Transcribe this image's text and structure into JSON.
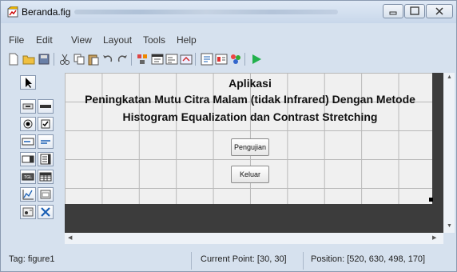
{
  "window": {
    "title": "Beranda.fig"
  },
  "menu": [
    "File",
    "Edit",
    "View",
    "Layout",
    "Tools",
    "Help"
  ],
  "toolbar_icons": [
    "new-file-icon",
    "open-folder-icon",
    "save-icon",
    "cut-icon",
    "copy-icon",
    "paste-icon",
    "undo-icon",
    "redo-icon",
    "align-icon",
    "menu-editor-icon",
    "tab-order-icon",
    "toolbar-editor-icon",
    "mfile-editor-icon",
    "property-inspector-icon",
    "object-browser-icon",
    "run-icon"
  ],
  "palette_icons": [
    "select-arrow-icon",
    "push-button-icon",
    "slider-icon",
    "radio-button-icon",
    "checkbox-icon",
    "edit-text-icon",
    "static-text-icon",
    "popup-menu-icon",
    "listbox-icon",
    "toggle-button-icon",
    "table-icon",
    "axes-icon",
    "panel-icon",
    "button-group-icon",
    "activex-icon"
  ],
  "canvas": {
    "line1": "Aplikasi",
    "line2": "Peningkatan Mutu Citra Malam (tidak Infrared) Dengan Metode",
    "line3": "Histogram Equalization dan Contrast Stretching",
    "button1": "Pengujian",
    "button2": "Keluar"
  },
  "status": {
    "tag": "Tag: figure1",
    "current_point": "Current Point:  [30, 30]",
    "position": "Position: [520, 630, 498, 170]"
  }
}
